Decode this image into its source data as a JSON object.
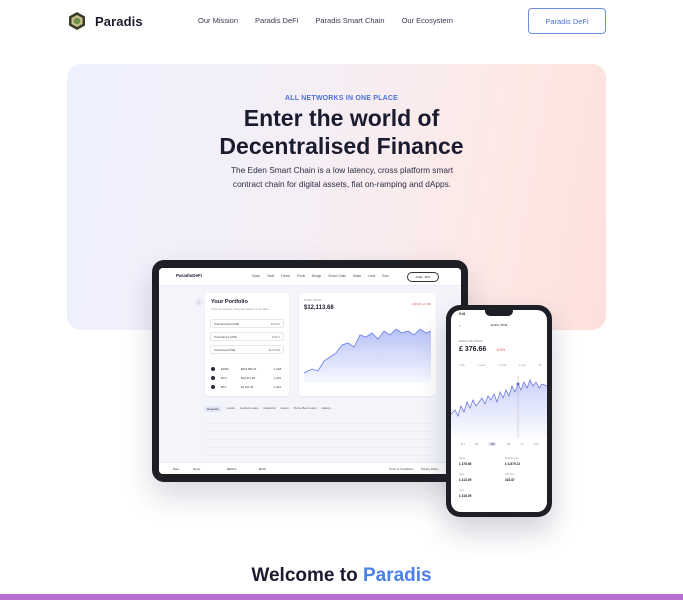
{
  "nav": {
    "brand": "Paradis",
    "links": [
      "Our Mission",
      "Paradis DeFi",
      "Paradis Smart Chain",
      "Our Ecosystem"
    ],
    "cta": "Paradis DeFi"
  },
  "hero": {
    "eyebrow": "ALL NETWORKS IN ONE PLACE",
    "title_line1": "Enter the world of",
    "title_line2": "Decentralised Finance",
    "desc": "The Eden Smart Chain is a low latency, cross platform smart contract chain for digital assets, fiat on-ramping and dApps."
  },
  "tablet": {
    "brand": "ParadisDeFi",
    "menu": [
      "Swap",
      "Vault",
      "Farms",
      "Pools",
      "Bridge",
      "Smart Chain",
      "Stake",
      "Lend",
      "Earn"
    ],
    "wallet": "0x9a...4f3c",
    "portfolio_title": "Your Portfolio",
    "portfolio_sub": "Track your holdings, history and valuation in one place",
    "rows": [
      {
        "label": "Total deposited (US$)",
        "value": "$12,113"
      },
      {
        "label": "Total claimed (US$)",
        "value": "$702.4"
      },
      {
        "label": "Total locked (US$)",
        "value": "$2,315.68"
      }
    ],
    "assets": [
      {
        "name": "EDDA",
        "v1": "$213,982.21",
        "v2": "1,218"
      },
      {
        "name": "ETH",
        "v1": "$13,271.09",
        "v2": "1,210"
      },
      {
        "name": "BTC",
        "v1": "$1,011.34",
        "v2": "1,021"
      }
    ],
    "chart_label": "TOTAL VALUE",
    "chart_value": "$12,113.68",
    "chart_change": "+ $36.00 (+0.3%)",
    "tabs": [
      "Deposits",
      "Lends",
      "Locked Loans",
      "Rewards",
      "Loans",
      "Pierre Bed Loans",
      "History"
    ],
    "footer": [
      "Rate",
      "Reset",
      "$EDDA",
      "$ETH",
      "Terms & Conditions",
      "Privacy Policy"
    ]
  },
  "phone": {
    "time": "9:41",
    "header": "EDDA / BNB",
    "label": "EDDA/USD PRICE",
    "price": "£ 376.66",
    "pct": "-5.8%",
    "axis": [
      "1 day",
      "1 week",
      "1 month",
      "1 year",
      "All"
    ],
    "ranges": [
      "1H",
      "1D",
      "1W",
      "1M",
      "1Y",
      "ALL"
    ],
    "stats": [
      {
        "k": "Open",
        "v": "£ 376.66"
      },
      {
        "k": "Market Cap",
        "v": "£ 4,879.12"
      },
      {
        "k": "High",
        "v": "£ 413.09"
      },
      {
        "k": "24h Vol",
        "v": "323.87"
      },
      {
        "k": "Low",
        "v": "£ 318.09"
      }
    ]
  },
  "welcome": {
    "prefix": "Welcome to ",
    "accent": "Paradis"
  },
  "colors": {
    "accent": "#4a80e8",
    "bottom_bar": "#b66fd2"
  }
}
